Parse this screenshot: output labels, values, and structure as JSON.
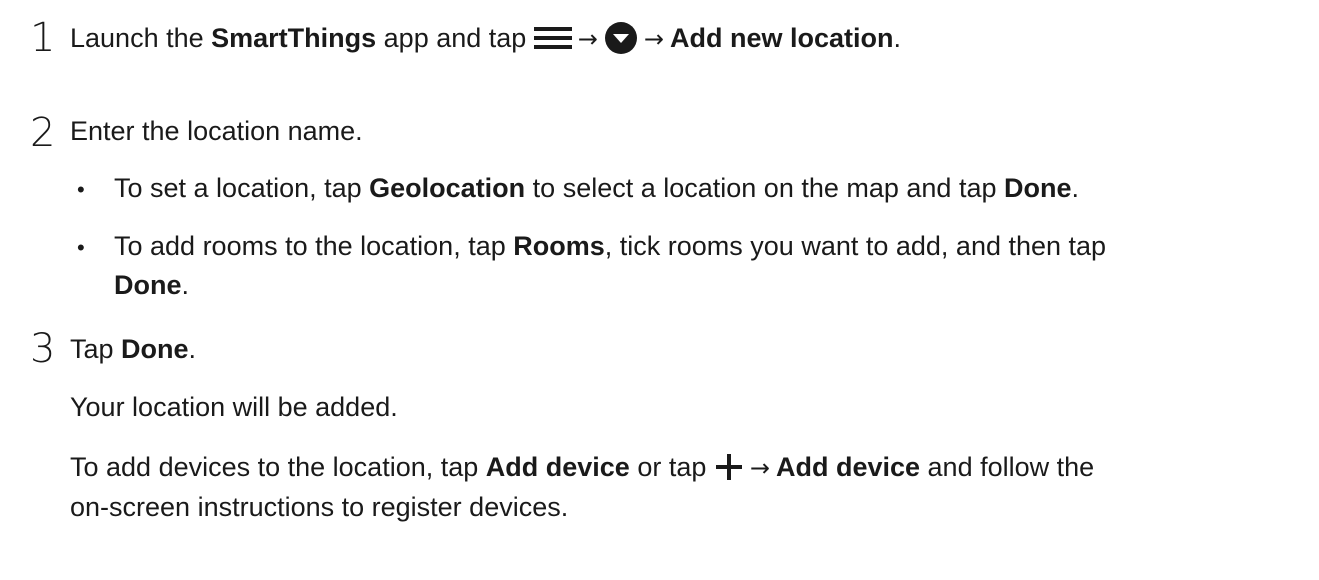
{
  "step1": {
    "number": "1",
    "text_before": "Launch the ",
    "app_name": "SmartThings",
    "text_mid": " app and tap ",
    "arrow_1": "→",
    "arrow_2": "→",
    "action": "Add new location",
    "end": "."
  },
  "step2": {
    "number": "2",
    "text": "Enter the location name.",
    "bullets": [
      {
        "marker": "•",
        "t1": "To set a location, tap ",
        "b1": "Geolocation",
        "t2": " to select a location on the map and tap ",
        "b2": "Done",
        "t3": "."
      },
      {
        "marker": "•",
        "t1": "To add rooms to the location, tap ",
        "b1": "Rooms",
        "t2": ", tick rooms you want to add, and then tap",
        "b2": "Done",
        "t3": "."
      }
    ]
  },
  "step3": {
    "number": "3",
    "t1": "Tap ",
    "b1": "Done",
    "t2": ".",
    "result": "Your location will be added.",
    "devices": {
      "t1": "To add devices to the location, tap ",
      "b1": "Add device",
      "t2": " or tap ",
      "arrow": "→",
      "b2": "Add device",
      "t3": " and follow the",
      "line2": "on-screen instructions to register devices."
    }
  },
  "icons": [
    "hamburger-icon",
    "chevron-circle-icon",
    "plus-icon"
  ]
}
